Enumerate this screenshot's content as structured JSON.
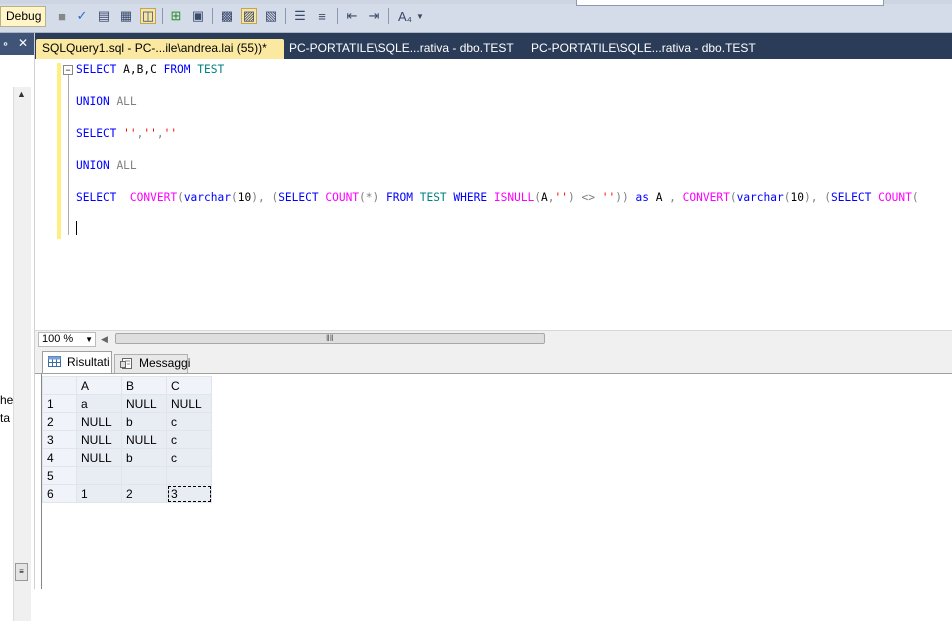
{
  "toolbar": {
    "config_value": "Debug"
  },
  "left_panel": {
    "pin_glyph": "॰",
    "close_glyph": "✕",
    "clip_text_1": "he",
    "clip_text_2": "ta"
  },
  "tabs": [
    {
      "label": "SQLQuery1.sql - PC-...ile\\andrea.lai (55))*",
      "active": true
    },
    {
      "label": "PC-PORTATILE\\SQLE...rativa - dbo.TEST",
      "active": false
    },
    {
      "label": "PC-PORTATILE\\SQLE...rativa - dbo.TEST",
      "active": false
    }
  ],
  "editor": {
    "lines": [
      "SELECT A,B,C FROM TEST",
      "UNION ALL",
      "SELECT '','',''",
      "UNION ALL",
      "SELECT  CONVERT(varchar(10), (SELECT COUNT(*) FROM TEST WHERE ISNULL(A,'') <> '')) as A , CONVERT(varchar(10), (SELECT COUNT("
    ]
  },
  "zoom": {
    "value": "100 %"
  },
  "results_tabs": {
    "results_label": "Risultati",
    "messages_label": "Messaggi"
  },
  "grid": {
    "columns": [
      "A",
      "B",
      "C"
    ],
    "rows": [
      {
        "n": "1",
        "a": "a",
        "b": "NULL",
        "c": "NULL"
      },
      {
        "n": "2",
        "a": "NULL",
        "b": "b",
        "c": "c"
      },
      {
        "n": "3",
        "a": "NULL",
        "b": "NULL",
        "c": "c"
      },
      {
        "n": "4",
        "a": "NULL",
        "b": "b",
        "c": "c"
      },
      {
        "n": "5",
        "a": "",
        "b": "",
        "c": ""
      },
      {
        "n": "6",
        "a": "1",
        "b": "2",
        "c": "3"
      }
    ]
  }
}
